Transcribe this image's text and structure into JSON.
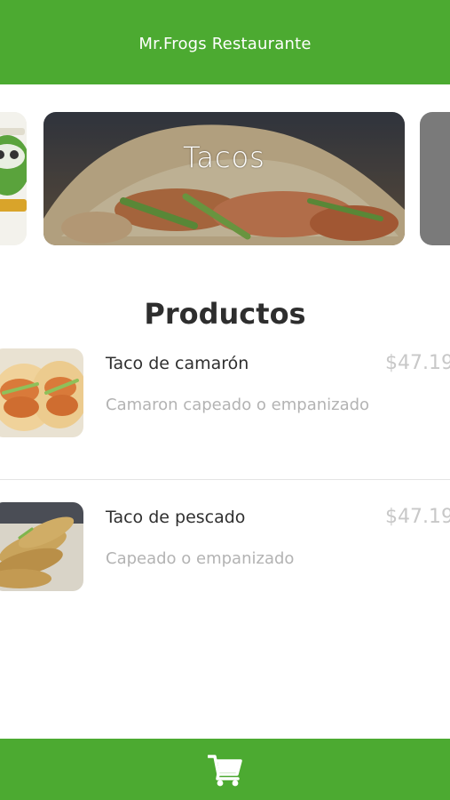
{
  "header": {
    "title": "Mr.Frogs Restaurante"
  },
  "carousel": {
    "cards": [
      {
        "label": "",
        "image": "restaurant-logo"
      },
      {
        "label": "Tacos",
        "image": "tacos-photo"
      },
      {
        "label": "",
        "image": "category-photo"
      }
    ]
  },
  "products": {
    "title": "Productos",
    "items": [
      {
        "name": "Taco de camarón",
        "description": "Camaron capeado o empanizado",
        "price": "$47.19",
        "image": "shrimp-taco-photo"
      },
      {
        "name": "Taco de pescado",
        "description": "Capeado o empanizado",
        "price": "$47.19",
        "image": "fish-taco-photo"
      }
    ]
  },
  "footer": {
    "icon": "shopping-cart-icon"
  },
  "colors": {
    "brand_green": "#4caa31",
    "price_gray": "#c8c8c8",
    "desc_gray": "#b3b3b3"
  }
}
